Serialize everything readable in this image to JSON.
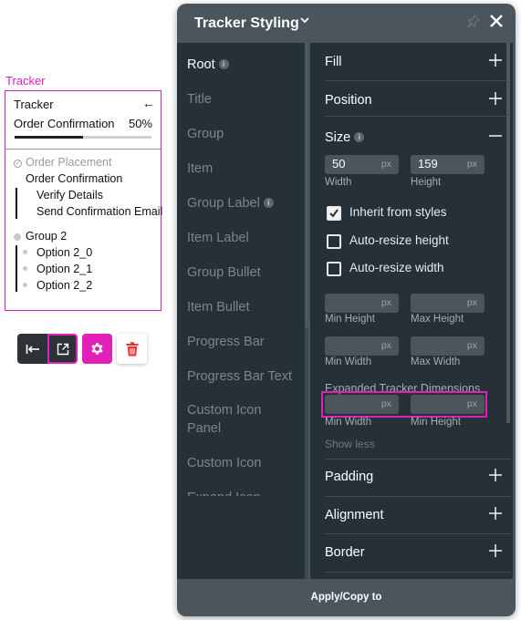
{
  "preview": {
    "caption": "Tracker",
    "title": "Tracker",
    "back_icon": "arrow-left-icon",
    "current_step": "Order Confirmation",
    "progress_label": "50%",
    "progress_fraction": 0.5,
    "items": [
      {
        "label": "Order Placement",
        "state": "completed"
      },
      {
        "label": "Order Confirmation",
        "state": "current"
      },
      {
        "label": "Verify Details",
        "state": "sub"
      },
      {
        "label": "Send Confirmation Email",
        "state": "sub"
      },
      {
        "label": "Group 2",
        "state": "group"
      },
      {
        "label": "Option 2_0",
        "state": "option"
      },
      {
        "label": "Option 2_1",
        "state": "option"
      },
      {
        "label": "Option 2_2",
        "state": "option"
      }
    ]
  },
  "toolbar": {
    "buttons": [
      {
        "name": "collapse-left",
        "icon": "collapse-left-icon"
      },
      {
        "name": "open-external",
        "icon": "external-link-icon"
      },
      {
        "name": "settings",
        "icon": "gear-icon"
      },
      {
        "name": "delete",
        "icon": "trash-icon"
      }
    ]
  },
  "panel": {
    "title": "Tracker Styling",
    "sidebar": [
      {
        "label": "Root",
        "active": true,
        "info": true
      },
      {
        "label": "Title"
      },
      {
        "label": "Group"
      },
      {
        "label": "Item"
      },
      {
        "label": "Group Label",
        "info": true
      },
      {
        "label": "Item Label"
      },
      {
        "label": "Group Bullet"
      },
      {
        "label": "Item Bullet"
      },
      {
        "label": "Progress Bar"
      },
      {
        "label": "Progress Bar Text"
      },
      {
        "label": "Custom Icon Panel"
      },
      {
        "label": "Custom Icon"
      },
      {
        "label": "Expand Icon"
      }
    ],
    "sections": {
      "fill": "Fill",
      "position": "Position",
      "size": "Size",
      "padding": "Padding",
      "alignment": "Alignment",
      "border": "Border"
    },
    "size": {
      "width": {
        "value": "50",
        "unit": "px",
        "label": "Width"
      },
      "height": {
        "value": "159",
        "unit": "px",
        "label": "Height"
      },
      "inherit": {
        "label": "Inherit from styles",
        "checked": true
      },
      "auto_height": {
        "label": "Auto-resize height",
        "checked": false
      },
      "auto_width": {
        "label": "Auto-resize width",
        "checked": false
      },
      "min_height": {
        "value": "",
        "unit": "px",
        "label": "Min Height"
      },
      "max_height": {
        "value": "",
        "unit": "px",
        "label": "Max Height"
      },
      "min_width": {
        "value": "",
        "unit": "px",
        "label": "Min Width"
      },
      "max_width": {
        "value": "",
        "unit": "px",
        "label": "Max Width"
      },
      "expanded_title": "Expanded Tracker Dimensions",
      "exp_min_width": {
        "value": "",
        "unit": "px",
        "label": "Min Width"
      },
      "exp_min_height": {
        "value": "",
        "unit": "px",
        "label": "Min Height"
      },
      "show_less": "Show less"
    },
    "footer": "Apply/Copy to"
  },
  "colors": {
    "accent": "#e21fb6",
    "panel_bg": "#263038",
    "panel_header": "#4b565c"
  }
}
